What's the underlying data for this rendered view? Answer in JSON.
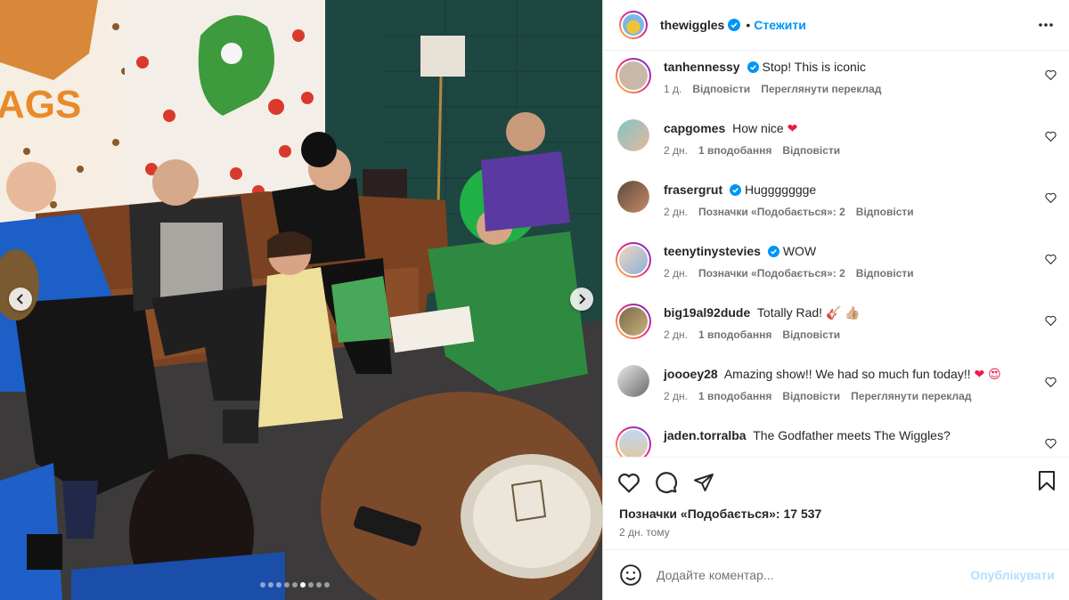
{
  "post": {
    "username": "thewiggles",
    "separator": "•",
    "follow_label": "Стежити",
    "more_icon": "more-horizontal-icon"
  },
  "comments": [
    {
      "username": "tanhennessy",
      "verified": true,
      "text": "Stop! This is iconic",
      "age": "1 д.",
      "likes": "",
      "reply": "Відповісти",
      "translate": "Переглянути переклад"
    },
    {
      "username": "capgomes",
      "verified": false,
      "text": "How nice",
      "emoji": "❤",
      "age": "2 дн.",
      "likes": "1 вподобання",
      "reply": "Відповісти",
      "translate": ""
    },
    {
      "username": "frasergrut",
      "verified": true,
      "text": "Huggggggge",
      "age": "2 дн.",
      "likes": "Позначки «Подобається»: 2",
      "reply": "Відповісти",
      "translate": ""
    },
    {
      "username": "teenytinystevies",
      "verified": true,
      "text": "WOW",
      "age": "2 дн.",
      "likes": "Позначки «Подобається»: 2",
      "reply": "Відповісти",
      "translate": ""
    },
    {
      "username": "big19al92dude",
      "verified": false,
      "text": "Totally Rad!",
      "emoji": "🎸 👍🏼",
      "age": "2 дн.",
      "likes": "1 вподобання",
      "reply": "Відповісти",
      "translate": ""
    },
    {
      "username": "joooey28",
      "verified": false,
      "text": "Amazing show!! We had so much fun today!!",
      "emoji": "❤ 😍",
      "age": "2 дн.",
      "likes": "1 вподобання",
      "reply": "Відповісти",
      "translate": "Переглянути переклад"
    },
    {
      "username": "jaden.torralba",
      "verified": false,
      "text": "The Godfather meets The Wiggles?",
      "age": "",
      "likes": "",
      "reply": "",
      "translate": ""
    }
  ],
  "likes_text": "Позначки «Подобається»: 17 537",
  "posted_time": "2 дн. тому",
  "add_comment": {
    "placeholder": "Додайте коментар...",
    "post_label": "Опублікувати"
  },
  "carousel": {
    "total_dots": 9,
    "active_index": 5
  },
  "colors": {
    "accent": "#0095f6",
    "text": "#262626",
    "muted": "#737373",
    "verified": "#0095f6",
    "heart": "#ed1a46"
  }
}
